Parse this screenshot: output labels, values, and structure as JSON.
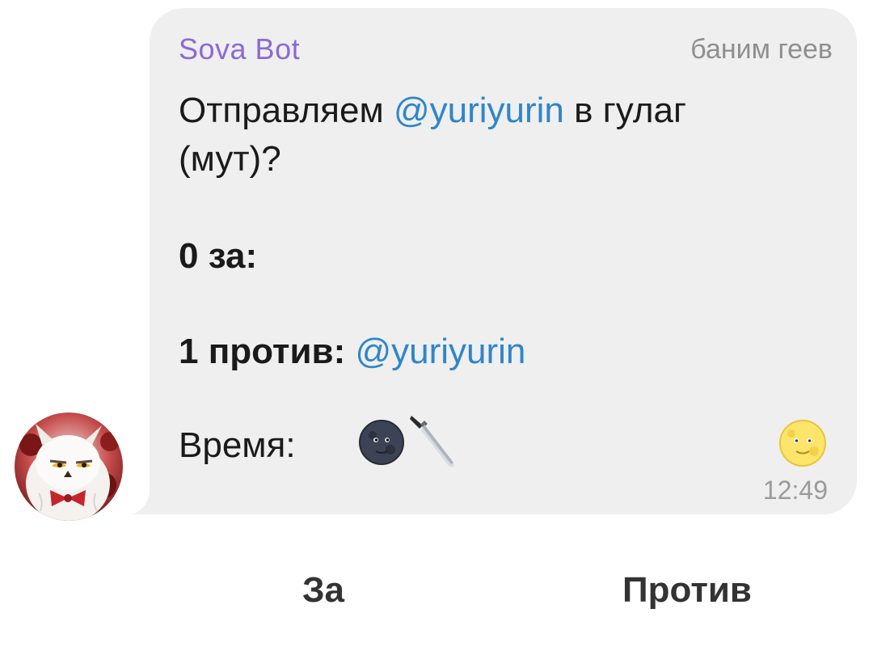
{
  "message": {
    "sender": "Sova Bot",
    "chat_tag": "баним геев",
    "line1_prefix": "Отправляем ",
    "line1_mention": "@yuriyurin",
    "line1_suffix": " в гулаг",
    "line2": "(мут)?",
    "votes_for": "0 за:",
    "votes_against_label": "1 против:",
    "votes_against_mention": "@yuriyurin",
    "time_label": "Время:",
    "timestamp": "12:49"
  },
  "icons": {
    "dark_moon": "new-moon-face-icon",
    "knife": "knife-icon",
    "full_moon": "full-moon-face-icon",
    "avatar": "owl-avatar"
  },
  "buttons": {
    "for_label": "За",
    "against_label": "Против"
  },
  "colors": {
    "sender": "#8a6ad6",
    "mention": "#2f86c9",
    "bubble": "#efefef"
  }
}
